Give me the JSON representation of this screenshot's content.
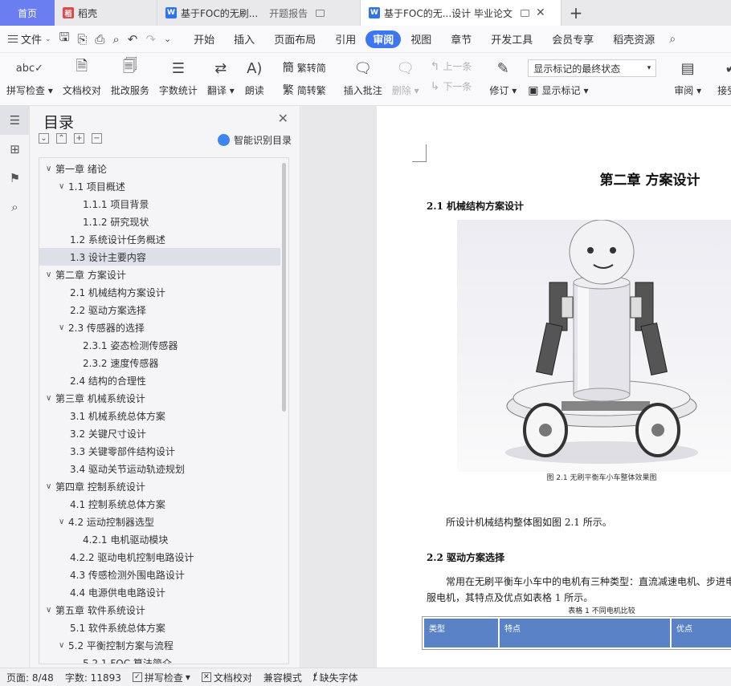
{
  "tabs": [
    {
      "label": "首页"
    },
    {
      "label": "稻壳"
    },
    {
      "label": "基于FOC的无刷...",
      "sub": "开题报告"
    },
    {
      "label": "基于FOC的无...设计 毕业论文"
    }
  ],
  "menu": {
    "file": "文件",
    "items": [
      "开始",
      "插入",
      "页面布局",
      "引用",
      "审阅",
      "视图",
      "章节",
      "开发工具",
      "会员专享",
      "稻壳资源"
    ],
    "active": "审阅"
  },
  "ribbon": {
    "spell": "拼写检查",
    "doc_check": "文档校对",
    "batch": "批改服务",
    "wordcount": "字数统计",
    "translate": "翻译",
    "read": "朗读",
    "to_trad": "繁转简",
    "to_simp": "简转繁",
    "insert_comment": "插入批注",
    "delete": "删除",
    "prev": "上一条",
    "next": "下一条",
    "revise": "修订",
    "show_markup": "显示标记",
    "markup_state": "显示标记的最终状态",
    "review": "审阅",
    "accept": "接受"
  },
  "toc": {
    "title": "目录",
    "smart": "智能识别目录",
    "items": [
      {
        "text": "第一章  绪论",
        "level": 0,
        "arrow": true
      },
      {
        "text": "1.1  项目概述",
        "level": 1,
        "arrow": true
      },
      {
        "text": "1.1.1  项目背景",
        "level": 2,
        "arrow": false
      },
      {
        "text": "1.1.2  研究现状",
        "level": 2,
        "arrow": false
      },
      {
        "text": "1.2  系统设计任务概述",
        "level": 1,
        "arrow": false
      },
      {
        "text": "1.3  设计主要内容",
        "level": 1,
        "arrow": false,
        "selected": true
      },
      {
        "text": "第二章  方案设计",
        "level": 0,
        "arrow": true
      },
      {
        "text": "2.1  机械结构方案设计",
        "level": 1,
        "arrow": false
      },
      {
        "text": "2.2  驱动方案选择",
        "level": 1,
        "arrow": false
      },
      {
        "text": "2.3  传感器的选择",
        "level": 1,
        "arrow": true
      },
      {
        "text": "2.3.1  姿态检测传感器",
        "level": 2,
        "arrow": false
      },
      {
        "text": "2.3.2  速度传感器",
        "level": 2,
        "arrow": false
      },
      {
        "text": "2.4  结构的合理性",
        "level": 1,
        "arrow": false
      },
      {
        "text": "第三章  机械系统设计",
        "level": 0,
        "arrow": true
      },
      {
        "text": "3.1  机械系统总体方案",
        "level": 1,
        "arrow": false
      },
      {
        "text": "3.2  关键尺寸设计",
        "level": 1,
        "arrow": false
      },
      {
        "text": "3.3  关键零部件结构设计",
        "level": 1,
        "arrow": false
      },
      {
        "text": "3.4  驱动关节运动轨迹规划",
        "level": 1,
        "arrow": false
      },
      {
        "text": "第四章  控制系统设计",
        "level": 0,
        "arrow": true
      },
      {
        "text": "4.1  控制系统总体方案",
        "level": 1,
        "arrow": false
      },
      {
        "text": "4.2  运动控制器选型",
        "level": 1,
        "arrow": true
      },
      {
        "text": "4.2.1  电机驱动模块",
        "level": 2,
        "arrow": false
      },
      {
        "text": "4.2.2  驱动电机控制电路设计",
        "level": 1,
        "arrow": false
      },
      {
        "text": "4.3  传感检测外围电路设计",
        "level": 1,
        "arrow": false
      },
      {
        "text": "4.4  电源供电电路设计",
        "level": 1,
        "arrow": false
      },
      {
        "text": "第五章  软件系统设计",
        "level": 0,
        "arrow": true
      },
      {
        "text": "5.1  软件系统总体方案",
        "level": 1,
        "arrow": false
      },
      {
        "text": "5.2  平衡控制方案与流程",
        "level": 1,
        "arrow": true
      },
      {
        "text": "5.2.1  FOC 算法简介",
        "level": 2,
        "arrow": false
      }
    ]
  },
  "document": {
    "chapter_title": "第二章   方案设计",
    "sec_2_1": "2.1 机械结构方案设计",
    "figure_caption": "图 2.1 无刷平衡车小车整体效果图",
    "para1": "所设计机械结构整体图如图 2.1 所示。",
    "sec_2_2": "2.2 驱动方案选择",
    "para2_line1": "常用在无刷平衡车小车中的电机有三种类型：直流减速电机、步进电",
    "para2_line2": "服电机，其特点及优点如表格 1 所示。",
    "table_caption": "表格 1 不同电机比较",
    "table_headers": [
      "类型",
      "特点",
      "优点"
    ]
  },
  "status": {
    "page": "页面: 8/48",
    "words": "字数: 11893",
    "spell": "拼写检查",
    "doc_check": "文档校对",
    "compat": "兼容模式",
    "missing_font": "缺失字体"
  },
  "colors": {
    "home_tab": "#6a7ef2",
    "active_menu": "#3d76f0",
    "table_header": "#5a83c7"
  }
}
